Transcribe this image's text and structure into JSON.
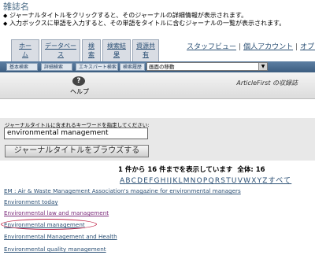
{
  "page": {
    "title": "雑誌名"
  },
  "instructions": [
    "ジャーナルタイトルをクリックすると、そのジャーナルの詳細情報が表示されます。",
    "入力ボックスに単語を入力すると、その単語をタイトルに含むジャーナルの一覧が表示されます。"
  ],
  "tabs": [
    {
      "line1": "ホー",
      "line2": "ム"
    },
    {
      "line1": "データベー",
      "line2": "ス"
    },
    {
      "line1": "検",
      "line2": "索"
    },
    {
      "line1": "検索結",
      "line2": "果"
    },
    {
      "line1": "資源共",
      "line2": "有"
    }
  ],
  "toplinks": {
    "staff_view": "スタッフビュー",
    "personal_account": "個人アカウント",
    "options": "オプシ"
  },
  "toolbar": {
    "basic_search": "基本検索",
    "advanced_search": "詳細検索",
    "expert_search": "エキスパート検索",
    "search_history": "検索履歴",
    "navigate_select": "画面の移動"
  },
  "helpbar": {
    "help_label": "ヘルプ",
    "database_name": "ArticleFirst の収録誌"
  },
  "search": {
    "label": "ジャーナルタイトルに含まれるキーワードを指定してください:",
    "value": "environmental management",
    "browse_button": "ジャーナルタイトルをブラウズする"
  },
  "results_info": {
    "showing": "1 件から 16 件までを表示しています",
    "total": "全体: 16"
  },
  "alphabet": [
    "A",
    "B",
    "C",
    "D",
    "E",
    "F",
    "G",
    "H",
    "I",
    "J",
    "K",
    "L",
    "M",
    "N",
    "O",
    "P",
    "Q",
    "R",
    "S",
    "T",
    "U",
    "V",
    "W",
    "X",
    "Y",
    "Z",
    "すべて"
  ],
  "results": [
    {
      "title": "EM : Air & Waste Management Association's magazine for environmental managers",
      "color": "#2a4f74"
    },
    {
      "title": "Environment today",
      "color": "#2a4f74"
    },
    {
      "title": "Environmental law and management",
      "color": "#7a2a7a"
    },
    {
      "title": "Environmental management",
      "color": "#2a4f74"
    },
    {
      "title": "Environmental Management and Health",
      "color": "#2a4f74"
    },
    {
      "title": "Environmental quality management",
      "color": "#2a4f74"
    }
  ],
  "colors": {
    "accent": "#2a4f74",
    "visited": "#7a2a7a",
    "highlight_circle": "#c0264a",
    "toolbar": "#4b6d92"
  }
}
